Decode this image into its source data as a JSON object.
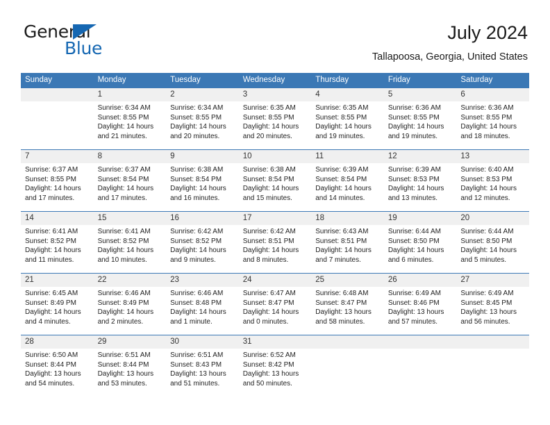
{
  "brand": {
    "general": "General",
    "blue": "Blue",
    "triangle_color": "#1567b2"
  },
  "header": {
    "title": "July 2024",
    "subtitle": "Tallapoosa, Georgia, United States",
    "accent_color": "#3b78b5",
    "daynum_bg": "#f0f0f0"
  },
  "weekdays": [
    "Sunday",
    "Monday",
    "Tuesday",
    "Wednesday",
    "Thursday",
    "Friday",
    "Saturday"
  ],
  "labels": {
    "sunrise_prefix": "Sunrise:",
    "sunset_prefix": "Sunset:",
    "daylight_prefix": "Daylight:"
  },
  "weeks": [
    [
      {
        "day": "",
        "empty": true,
        "sunrise": "",
        "sunset": "",
        "daylight1": "",
        "daylight2": ""
      },
      {
        "day": "1",
        "sunrise": "Sunrise: 6:34 AM",
        "sunset": "Sunset: 8:55 PM",
        "daylight1": "Daylight: 14 hours",
        "daylight2": "and 21 minutes."
      },
      {
        "day": "2",
        "sunrise": "Sunrise: 6:34 AM",
        "sunset": "Sunset: 8:55 PM",
        "daylight1": "Daylight: 14 hours",
        "daylight2": "and 20 minutes."
      },
      {
        "day": "3",
        "sunrise": "Sunrise: 6:35 AM",
        "sunset": "Sunset: 8:55 PM",
        "daylight1": "Daylight: 14 hours",
        "daylight2": "and 20 minutes."
      },
      {
        "day": "4",
        "sunrise": "Sunrise: 6:35 AM",
        "sunset": "Sunset: 8:55 PM",
        "daylight1": "Daylight: 14 hours",
        "daylight2": "and 19 minutes."
      },
      {
        "day": "5",
        "sunrise": "Sunrise: 6:36 AM",
        "sunset": "Sunset: 8:55 PM",
        "daylight1": "Daylight: 14 hours",
        "daylight2": "and 19 minutes."
      },
      {
        "day": "6",
        "sunrise": "Sunrise: 6:36 AM",
        "sunset": "Sunset: 8:55 PM",
        "daylight1": "Daylight: 14 hours",
        "daylight2": "and 18 minutes."
      }
    ],
    [
      {
        "day": "7",
        "sunrise": "Sunrise: 6:37 AM",
        "sunset": "Sunset: 8:55 PM",
        "daylight1": "Daylight: 14 hours",
        "daylight2": "and 17 minutes."
      },
      {
        "day": "8",
        "sunrise": "Sunrise: 6:37 AM",
        "sunset": "Sunset: 8:54 PM",
        "daylight1": "Daylight: 14 hours",
        "daylight2": "and 17 minutes."
      },
      {
        "day": "9",
        "sunrise": "Sunrise: 6:38 AM",
        "sunset": "Sunset: 8:54 PM",
        "daylight1": "Daylight: 14 hours",
        "daylight2": "and 16 minutes."
      },
      {
        "day": "10",
        "sunrise": "Sunrise: 6:38 AM",
        "sunset": "Sunset: 8:54 PM",
        "daylight1": "Daylight: 14 hours",
        "daylight2": "and 15 minutes."
      },
      {
        "day": "11",
        "sunrise": "Sunrise: 6:39 AM",
        "sunset": "Sunset: 8:54 PM",
        "daylight1": "Daylight: 14 hours",
        "daylight2": "and 14 minutes."
      },
      {
        "day": "12",
        "sunrise": "Sunrise: 6:39 AM",
        "sunset": "Sunset: 8:53 PM",
        "daylight1": "Daylight: 14 hours",
        "daylight2": "and 13 minutes."
      },
      {
        "day": "13",
        "sunrise": "Sunrise: 6:40 AM",
        "sunset": "Sunset: 8:53 PM",
        "daylight1": "Daylight: 14 hours",
        "daylight2": "and 12 minutes."
      }
    ],
    [
      {
        "day": "14",
        "sunrise": "Sunrise: 6:41 AM",
        "sunset": "Sunset: 8:52 PM",
        "daylight1": "Daylight: 14 hours",
        "daylight2": "and 11 minutes."
      },
      {
        "day": "15",
        "sunrise": "Sunrise: 6:41 AM",
        "sunset": "Sunset: 8:52 PM",
        "daylight1": "Daylight: 14 hours",
        "daylight2": "and 10 minutes."
      },
      {
        "day": "16",
        "sunrise": "Sunrise: 6:42 AM",
        "sunset": "Sunset: 8:52 PM",
        "daylight1": "Daylight: 14 hours",
        "daylight2": "and 9 minutes."
      },
      {
        "day": "17",
        "sunrise": "Sunrise: 6:42 AM",
        "sunset": "Sunset: 8:51 PM",
        "daylight1": "Daylight: 14 hours",
        "daylight2": "and 8 minutes."
      },
      {
        "day": "18",
        "sunrise": "Sunrise: 6:43 AM",
        "sunset": "Sunset: 8:51 PM",
        "daylight1": "Daylight: 14 hours",
        "daylight2": "and 7 minutes."
      },
      {
        "day": "19",
        "sunrise": "Sunrise: 6:44 AM",
        "sunset": "Sunset: 8:50 PM",
        "daylight1": "Daylight: 14 hours",
        "daylight2": "and 6 minutes."
      },
      {
        "day": "20",
        "sunrise": "Sunrise: 6:44 AM",
        "sunset": "Sunset: 8:50 PM",
        "daylight1": "Daylight: 14 hours",
        "daylight2": "and 5 minutes."
      }
    ],
    [
      {
        "day": "21",
        "sunrise": "Sunrise: 6:45 AM",
        "sunset": "Sunset: 8:49 PM",
        "daylight1": "Daylight: 14 hours",
        "daylight2": "and 4 minutes."
      },
      {
        "day": "22",
        "sunrise": "Sunrise: 6:46 AM",
        "sunset": "Sunset: 8:49 PM",
        "daylight1": "Daylight: 14 hours",
        "daylight2": "and 2 minutes."
      },
      {
        "day": "23",
        "sunrise": "Sunrise: 6:46 AM",
        "sunset": "Sunset: 8:48 PM",
        "daylight1": "Daylight: 14 hours",
        "daylight2": "and 1 minute."
      },
      {
        "day": "24",
        "sunrise": "Sunrise: 6:47 AM",
        "sunset": "Sunset: 8:47 PM",
        "daylight1": "Daylight: 14 hours",
        "daylight2": "and 0 minutes."
      },
      {
        "day": "25",
        "sunrise": "Sunrise: 6:48 AM",
        "sunset": "Sunset: 8:47 PM",
        "daylight1": "Daylight: 13 hours",
        "daylight2": "and 58 minutes."
      },
      {
        "day": "26",
        "sunrise": "Sunrise: 6:49 AM",
        "sunset": "Sunset: 8:46 PM",
        "daylight1": "Daylight: 13 hours",
        "daylight2": "and 57 minutes."
      },
      {
        "day": "27",
        "sunrise": "Sunrise: 6:49 AM",
        "sunset": "Sunset: 8:45 PM",
        "daylight1": "Daylight: 13 hours",
        "daylight2": "and 56 minutes."
      }
    ],
    [
      {
        "day": "28",
        "sunrise": "Sunrise: 6:50 AM",
        "sunset": "Sunset: 8:44 PM",
        "daylight1": "Daylight: 13 hours",
        "daylight2": "and 54 minutes."
      },
      {
        "day": "29",
        "sunrise": "Sunrise: 6:51 AM",
        "sunset": "Sunset: 8:44 PM",
        "daylight1": "Daylight: 13 hours",
        "daylight2": "and 53 minutes."
      },
      {
        "day": "30",
        "sunrise": "Sunrise: 6:51 AM",
        "sunset": "Sunset: 8:43 PM",
        "daylight1": "Daylight: 13 hours",
        "daylight2": "and 51 minutes."
      },
      {
        "day": "31",
        "sunrise": "Sunrise: 6:52 AM",
        "sunset": "Sunset: 8:42 PM",
        "daylight1": "Daylight: 13 hours",
        "daylight2": "and 50 minutes."
      },
      {
        "day": "",
        "empty": true,
        "sunrise": "",
        "sunset": "",
        "daylight1": "",
        "daylight2": ""
      },
      {
        "day": "",
        "empty": true,
        "sunrise": "",
        "sunset": "",
        "daylight1": "",
        "daylight2": ""
      },
      {
        "day": "",
        "empty": true,
        "sunrise": "",
        "sunset": "",
        "daylight1": "",
        "daylight2": ""
      }
    ]
  ]
}
